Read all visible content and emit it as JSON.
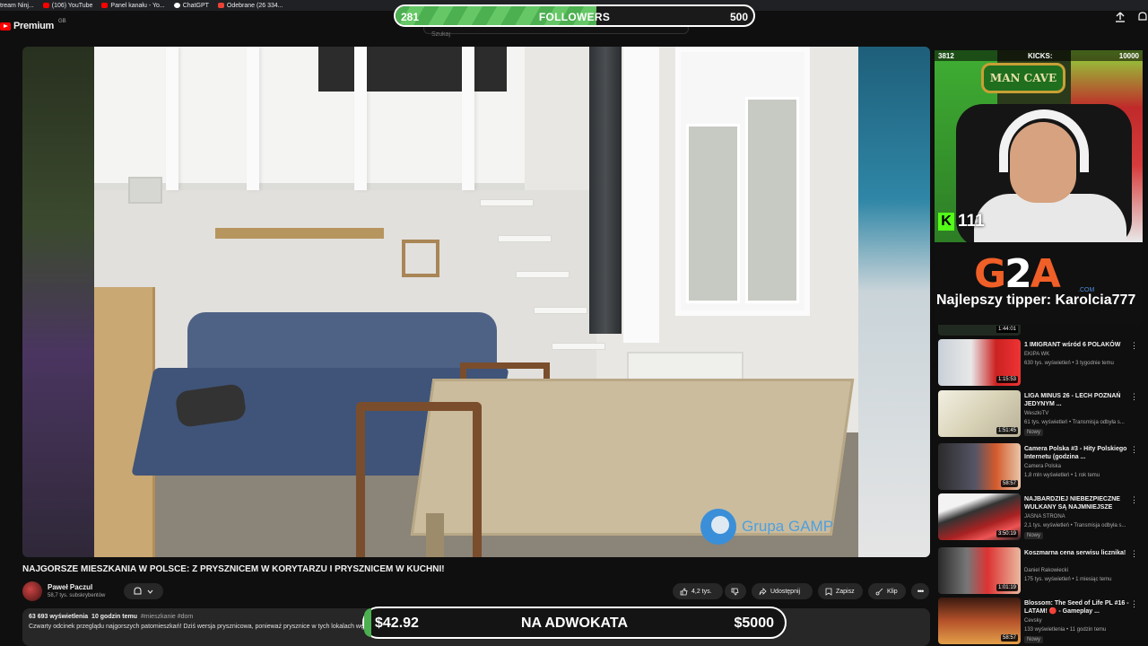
{
  "bookmarks": [
    "tream Ninj...",
    "(106) YouTube",
    "Panel kanału - Yo...",
    "ChatGPT",
    "Odebrane (26 334..."
  ],
  "masthead": {
    "logo_text": "Premium",
    "logo_sup": "GB",
    "search_placeholder": "Szukaj"
  },
  "followers_bar": {
    "current": "281",
    "label": "FOLLOWERS",
    "goal": "500",
    "progress_fraction": 0.562
  },
  "video": {
    "watermark": "Grupa GAMP",
    "title": "NAJGORSZE MIESZKANIA W POLSCE: Z PRYSZNICEM W KORYTARZU I PRYSZNICEM W KUCHNI!",
    "channel_name": "Paweł Paczul",
    "channel_subs": "58,7 tys. subskrybentów",
    "likes": "4,2 tys.",
    "share_label": "Udostępnij",
    "save_label": "Zapisz",
    "clip_label": "Klip",
    "views": "63 693 wyświetlenia",
    "time_ago": "10 godzin temu",
    "tags": "#mieszkanie #dom",
    "description": "Czwarty odcinek przeglądu najgorszych patomieszkań! Dziś wersja prysznicowa, ponieważ prysznice w tych lokalach wędrują w różne miejsca."
  },
  "donation_bar": {
    "current": "$42.92",
    "label": "NA ADWOKATA",
    "goal": "$5000",
    "progress_fraction": 0.0086
  },
  "webcam": {
    "sign_text": "MAN CAVE",
    "top_left": "3812",
    "top_mid": "KICKS:",
    "top_right": "10000",
    "kick_viewers": "111"
  },
  "g2a": {
    "logo_g": "G",
    "logo_2": "2",
    "logo_a": "A",
    "com": ".COM",
    "top_tipper": "Najlepszy tipper: Karolcia777"
  },
  "recommendations": {
    "faded_duration": "1:44:01",
    "items": [
      {
        "title": "1 IMIGRANT wśród 6 POLAKÓW",
        "channel": "EKIPA WK",
        "meta": "630 tys. wyświetleń • 3 tygodnie temu",
        "duration": "1:15:53",
        "badge": ""
      },
      {
        "title": "LIGA MINUS 26 - LECH POZNAŃ JEDYNYM ...",
        "channel": "WeszłoTV",
        "meta": "61 tys. wyświetleń • Transmisja odbyła s...",
        "duration": "1:51:45",
        "badge": "Nowy"
      },
      {
        "title": "Camera Polska #3 - Hity Polskiego Internetu (godzina ...",
        "channel": "Camera Polska",
        "meta": "1,8 mln wyświetleń • 1 rok temu",
        "duration": "58:57",
        "badge": ""
      },
      {
        "title": "NAJBARDZIEJ NIEBEZPIECZNE WULKANY SĄ NAJMNIEJSZE",
        "channel": "JASNA STRONA",
        "meta": "2,1 tys. wyświetleń • Transmisja odbyła s...",
        "duration": "3:50:19",
        "badge": "Nowy"
      },
      {
        "title": "Koszmarna cena serwisu licznika!",
        "channel": "Daniel Rakowiecki",
        "meta": "175 tys. wyświetleń • 1 miesiąc temu",
        "duration": "1:01:19",
        "badge": ""
      },
      {
        "title": "Blossom: The Seed of Life PL #16 - LATAM! 🔴 - Gameplay ...",
        "channel": "Cevsky",
        "meta": "133 wyświetlenia • 11 godzin temu",
        "duration": "58:57",
        "badge": "Nowy"
      }
    ]
  },
  "colors": {
    "accent_green": "#4caf50",
    "brand_red": "#ff0000",
    "g2a_orange": "#f05f27",
    "kick_green": "#53fc18"
  },
  "icons": [
    "youtube-logo-icon",
    "keyboard-icon",
    "search-icon",
    "mic-icon",
    "upload-icon",
    "bell-icon",
    "like-icon",
    "dislike-icon",
    "share-icon",
    "save-icon",
    "clip-icon",
    "more-icon"
  ]
}
